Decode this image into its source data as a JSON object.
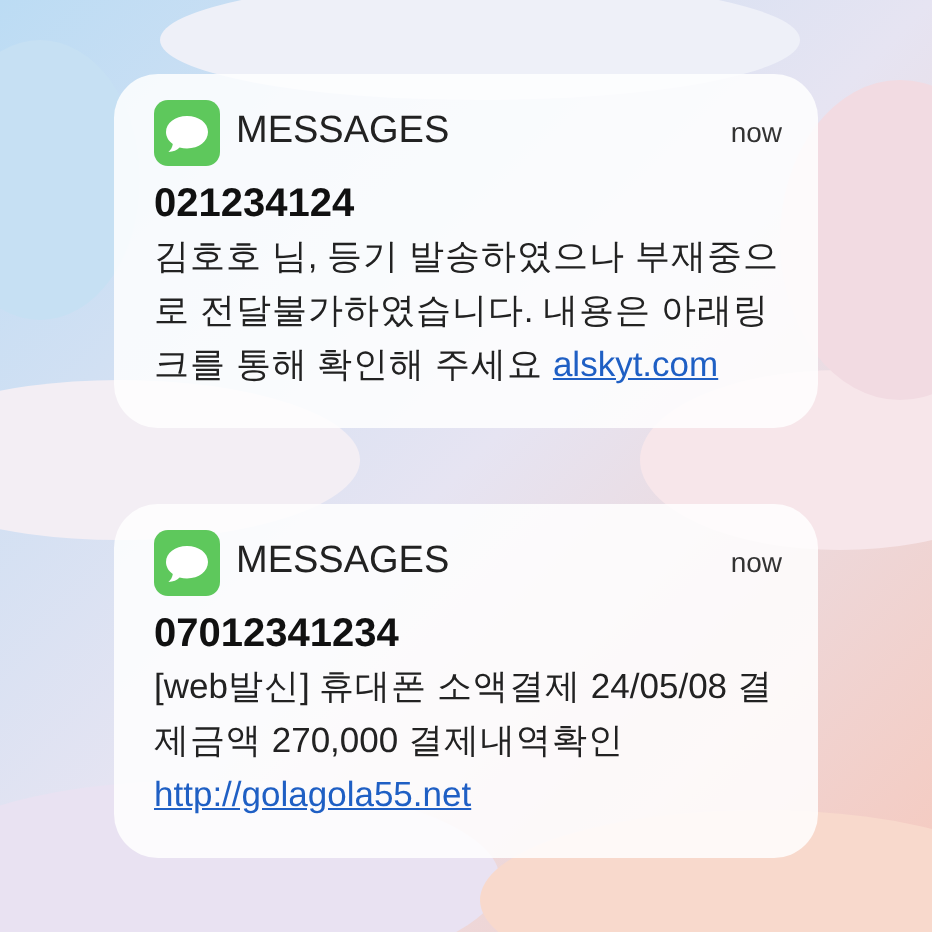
{
  "notifications": [
    {
      "app": "MESSAGES",
      "time": "now",
      "sender": "021234124",
      "body": "김호호 님, 등기 발송하였으나 부재중으로 전달불가하였습니다. 내용은 아래링크를 통해 확인해 주세요",
      "link": "alskyt.com"
    },
    {
      "app": "MESSAGES",
      "time": "now",
      "sender": "07012341234",
      "body": "[web발신] 휴대폰 소액결제 24/05/08 결제금액 270,000 결제내역확인",
      "link": "http://golagola55.net"
    }
  ]
}
